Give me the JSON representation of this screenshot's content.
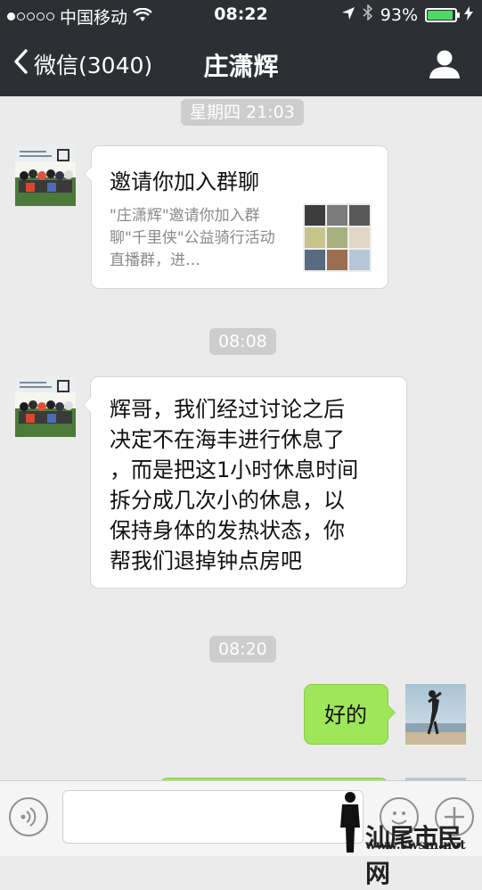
{
  "status_bar": {
    "carrier": "中国移动",
    "time": "08:22",
    "battery": "93%",
    "battery_level": 0.93,
    "signal_bars_filled": 1,
    "signal_bars_total": 5
  },
  "nav": {
    "back_label": "微信(3040)",
    "title": "庄潇辉"
  },
  "messages": {
    "time1": "星期四 21:03",
    "invite": {
      "title": "邀请你加入群聊",
      "desc": "\"庄潇辉\"邀请你加入群聊\"千里侠\"公益骑行活动直播群，进…"
    },
    "time2": "08:08",
    "incoming_text_lines": [
      "辉哥，我们经过讨论之后",
      "决定不在海丰进行休息了",
      "，而是把这1小时休息时间",
      "拆分成几次小的休息，以",
      "保持身体的发热状态，你",
      "帮我们退掉钟点房吧"
    ],
    "time3": "08:20",
    "outgoing_text": "好的"
  },
  "watermark": {
    "text": "汕尾市民网",
    "url": "www.swsm.net"
  },
  "colors": {
    "nav_bg": "#2c2f34",
    "chat_bg": "#ebebeb",
    "outgoing_bubble": "#9fe658",
    "battery_green": "#4cd964"
  },
  "icons": {
    "back": "chevron-left-icon",
    "profile": "person-icon",
    "wifi": "wifi-icon",
    "location": "location-arrow-icon",
    "bluetooth": "bluetooth-icon",
    "charging": "lightning-icon",
    "voice": "voice-icon",
    "emoji": "emoji-icon",
    "plus": "plus-icon"
  }
}
